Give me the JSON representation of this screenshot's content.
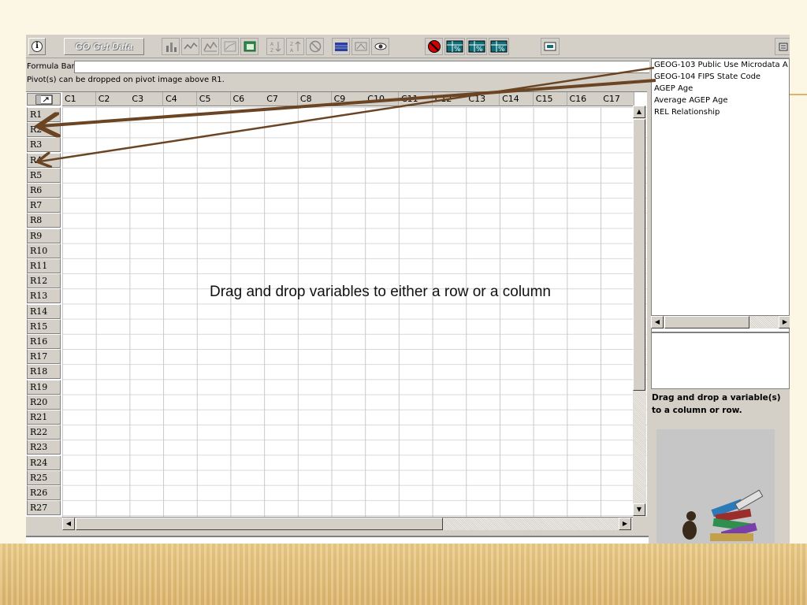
{
  "toolbar": {
    "go_button_label": "GO Get Data"
  },
  "formula_bar": {
    "label": "Formula Bar",
    "value": ""
  },
  "pivot_note": "Pivot(s) can be dropped on pivot image above R1.",
  "grid": {
    "columns": [
      "C1",
      "C2",
      "C3",
      "C4",
      "C5",
      "C6",
      "C7",
      "C8",
      "C9",
      "C10",
      "C11",
      "C12",
      "C13",
      "C14",
      "C15",
      "C16",
      "C17"
    ],
    "rows": [
      "R1",
      "R2",
      "R3",
      "R4",
      "R5",
      "R6",
      "R7",
      "R8",
      "R9",
      "R10",
      "R11",
      "R12",
      "R13",
      "R14",
      "R15",
      "R16",
      "R17",
      "R18",
      "R19",
      "R20",
      "R21",
      "R22",
      "R23",
      "R24",
      "R25",
      "R26",
      "R27"
    ]
  },
  "variables": [
    "GEOG-103 Public Use Microdata A",
    "GEOG-104 FIPS State Code",
    "AGEP Age",
    "Average AGEP Age",
    "REL Relationship"
  ],
  "hint": "Drag and drop a variable(s) to a column or row.",
  "annotation": "Drag and drop variables to either a row or a column",
  "colors": {
    "arrow": "#6b4423",
    "window": "#d4d0c8",
    "slide_bottom": "#e2bd74"
  }
}
